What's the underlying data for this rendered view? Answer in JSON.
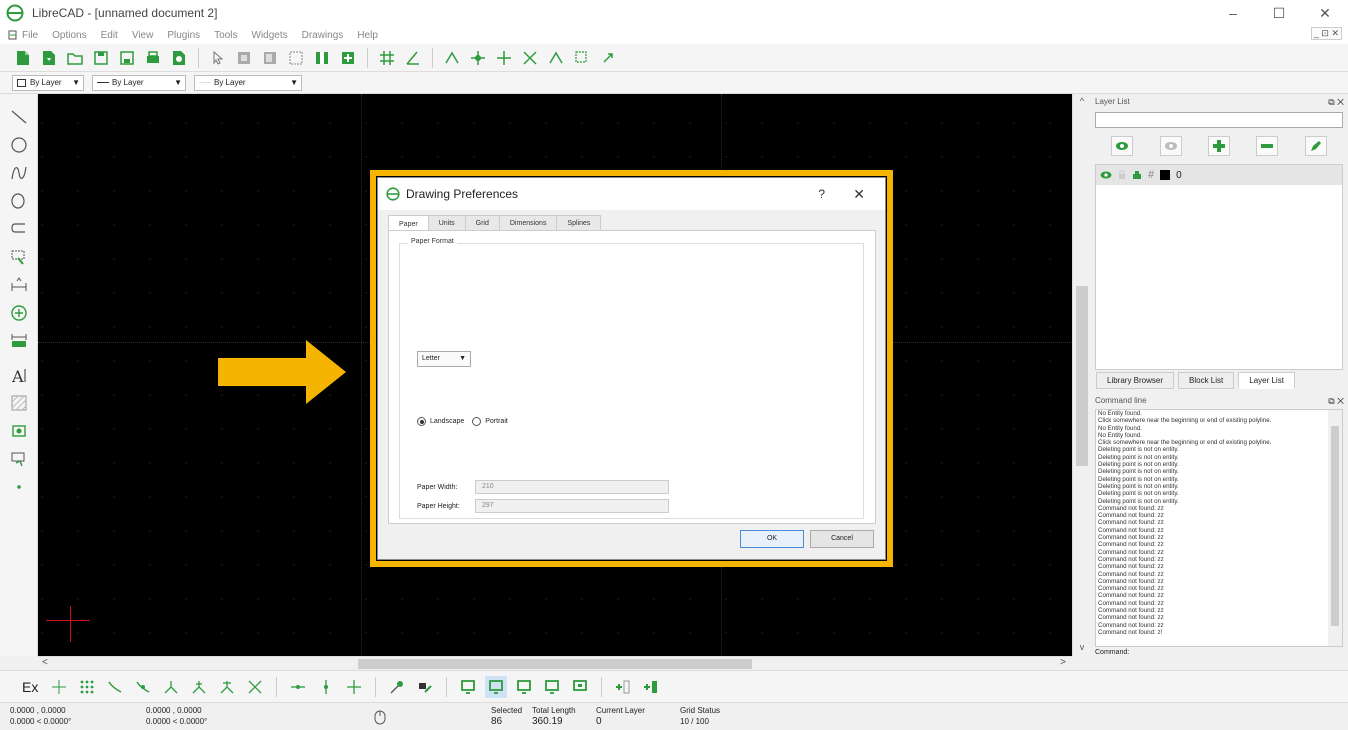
{
  "window": {
    "title": "LibreCAD - [unnamed document 2]",
    "minimize": "–",
    "maximize": "☐",
    "close": "✕"
  },
  "menu": {
    "items": [
      "File",
      "Options",
      "Edit",
      "View",
      "Plugins",
      "Tools",
      "Widgets",
      "Drawings",
      "Help"
    ],
    "doc_controls": "_ ⊡ ✕"
  },
  "attributes": {
    "color": "By Layer",
    "line_width": "By Layer",
    "line_type": "By Layer"
  },
  "dialog": {
    "title": "Drawing Preferences",
    "help": "?",
    "close": "✕",
    "tabs": [
      "Paper",
      "Units",
      "Grid",
      "Dimensions",
      "Splines"
    ],
    "active_tab": "Paper",
    "group_label": "Paper Format",
    "paper_size": "Letter",
    "orientation_landscape": "Landscape",
    "orientation_portrait": "Portrait",
    "orientation_selected": "Landscape",
    "paper_width_label": "Paper Width:",
    "paper_width": "210",
    "paper_height_label": "Paper Height:",
    "paper_height": "297",
    "ok": "OK",
    "cancel": "Cancel"
  },
  "layer_list": {
    "title": "Layer List",
    "layers": [
      {
        "name": "0"
      }
    ]
  },
  "dock_tabs": [
    "Library Browser",
    "Block List",
    "Layer List"
  ],
  "command_line": {
    "title": "Command line",
    "lines": [
      "No Entity found.",
      "Click somewhere near the beginning or end of existing polyline.",
      "No Entity found.",
      "No Entity found.",
      "Click somewhere near the beginning or end of existing polyline.",
      "Deleting point is not on entity.",
      "Deleting point is not on entity.",
      "Deleting point is not on entity.",
      "Deleting point is not on entity.",
      "Deleting point is not on entity.",
      "Deleting point is not on entity.",
      "Deleting point is not on entity.",
      "Deleting point is not on entity.",
      "Command not found: zz",
      "Command not found: zz",
      "Command not found: zz",
      "Command not found: zz",
      "Command not found: zz",
      "Command not found: zz",
      "Command not found: zz",
      "Command not found: zz",
      "Command not found: zz",
      "Command not found: zz",
      "Command not found: zz",
      "Command not found: zz",
      "Command not found: zz",
      "Command not found: zz",
      "Command not found: zz",
      "Command not found: zz",
      "Command not found: zz",
      "Command not found: z!"
    ],
    "prompt": "Command:"
  },
  "snap": {
    "ex_label": "Ex"
  },
  "status": {
    "abs_coord": "0.0000 , 0.0000",
    "abs_polar": "0.0000 < 0.0000°",
    "rel_coord": "0.0000 , 0.0000",
    "rel_polar": "0.0000 < 0.0000°",
    "selected_label": "Selected",
    "selected": "86",
    "total_length_label": "Total Length",
    "total_length": "360.19",
    "current_layer_label": "Current Layer",
    "current_layer": "0",
    "grid_status_label": "Grid Status",
    "grid_status": "10 / 100"
  },
  "colors": {
    "accent": "#f5b400",
    "icon_green": "#2e9b3e",
    "canvas": "#000000"
  }
}
